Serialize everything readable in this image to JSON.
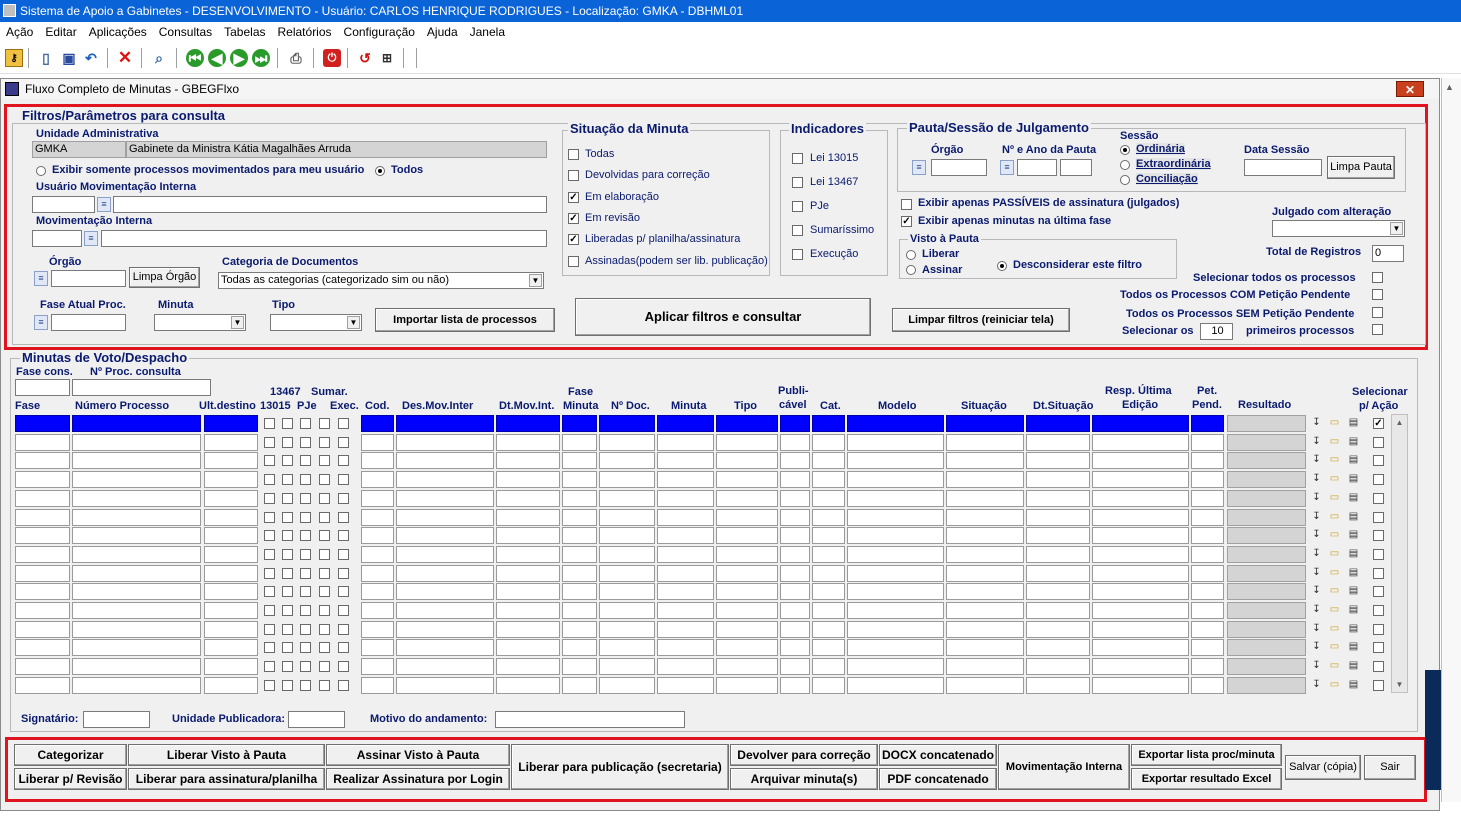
{
  "window": {
    "title": "Sistema de Apoio a Gabinetes - DESENVOLVIMENTO - Usuário: CARLOS HENRIQUE RODRIGUES - Localização: GMKA - DBHML01"
  },
  "menu": [
    "Ação",
    "Editar",
    "Aplicações",
    "Consultas",
    "Tabelas",
    "Relatórios",
    "Configuração",
    "Ajuda",
    "Janela"
  ],
  "form": {
    "title": "Fluxo Completo de Minutas - GBEGFlxo",
    "close": "✕"
  },
  "filters": {
    "title": "Filtros/Parâmetros para consulta",
    "unidade_label": "Unidade Administrativa",
    "unidade_code": "GMKA",
    "unidade_name": "Gabinete da Ministra Kátia Magalhães Arruda",
    "radio_meus": "Exibir somente processos movimentados para meu usuário",
    "radio_todos": "Todos",
    "usuario_label": "Usuário Movimentação Interna",
    "mov_label": "Movimentação Interna",
    "orgao_label": "Órgão",
    "limpa_orgao": "Limpa Órgão",
    "categoria_label": "Categoria de Documentos",
    "categoria_value": "Todas as categorias (categorizado sim ou não)",
    "fase_label": "Fase Atual Proc.",
    "minuta_label": "Minuta",
    "tipo_label": "Tipo",
    "importar": "Importar lista de processos",
    "aplicar": "Aplicar filtros e consultar",
    "limpar": "Limpar filtros (reiniciar tela)"
  },
  "situacao": {
    "title": "Situação da Minuta",
    "items": [
      {
        "label": "Todas",
        "checked": ""
      },
      {
        "label": "Devolvidas para correção",
        "checked": ""
      },
      {
        "label": "Em elaboração",
        "checked": "✓"
      },
      {
        "label": "Em revisão",
        "checked": "✓"
      },
      {
        "label": "Liberadas p/ planilha/assinatura",
        "checked": "✓"
      },
      {
        "label": "Assinadas(podem ser lib. publicação)",
        "checked": ""
      }
    ]
  },
  "indicadores": {
    "title": "Indicadores",
    "items": [
      {
        "label": "Lei 13015",
        "checked": ""
      },
      {
        "label": "Lei 13467",
        "checked": ""
      },
      {
        "label": "PJe",
        "checked": ""
      },
      {
        "label": "Sumaríssimo",
        "checked": ""
      },
      {
        "label": "Execução",
        "checked": ""
      }
    ]
  },
  "pauta": {
    "title": "Pauta/Sessão de Julgamento",
    "orgao": "Órgão",
    "numero_ano": "Nº e Ano da Pauta",
    "sessao": "Sessão",
    "ordinaria": "Ordinária",
    "extraordinaria": "Extraordinária",
    "conciliacao": "Conciliação",
    "data_sessao": "Data Sessão",
    "limpa_pauta": "Limpa Pauta",
    "passiveis": "Exibir apenas PASSÍVEIS de assinatura (julgados)",
    "passiveis_checked": "",
    "ultima_fase": "Exibir apenas minutas na última fase",
    "ultima_fase_checked": "✓",
    "visto_title": "Visto à Pauta",
    "liberar": "Liberar",
    "assinar": "Assinar",
    "desconsiderar": "Desconsiderar este filtro",
    "julgado": "Julgado com alteração",
    "total_label": "Total de Registros",
    "total_value": "0",
    "sel_todos": "Selecionar todos os processos",
    "com_peticao": "Todos os Processos COM Petição Pendente",
    "sem_peticao": "Todos os Processos SEM Petição Pendente",
    "selecionar_os": "Selecionar os",
    "selecionar_n": "10",
    "primeiros": "primeiros processos"
  },
  "grid": {
    "title": "Minutas de Voto/Despacho",
    "fase_cons": "Fase cons.",
    "n_proc_consulta": "Nº Proc. consulta",
    "headers": {
      "fase": "Fase",
      "numero": "Número Processo",
      "ult": "Ult.destino",
      "l13467": "13467",
      "l13015": "13015",
      "pje": "PJe",
      "sumar": "Sumar.",
      "exec": "Exec.",
      "cod": "Cod.",
      "desmov": "Des.Mov.Inter",
      "dtmov": "Dt.Mov.Int.",
      "fase_top": "Fase",
      "fase_bot": "Minuta",
      "ndoc": "Nº Doc.",
      "minuta": "Minuta",
      "tipo": "Tipo",
      "pub_top": "Publi-",
      "pub_bot": "cável",
      "cat": "Cat.",
      "modelo": "Modelo",
      "situacao": "Situação",
      "dtsit": "Dt.Situação",
      "resp_top": "Resp. Última",
      "resp_bot": "Edição",
      "pet_top": "Pet.",
      "pet_bot": "Pend.",
      "resultado": "Resultado",
      "sel_top": "Selecionar",
      "sel_bot": "p/ Ação"
    },
    "row_count": 15,
    "first_row_selected_checked": "✓"
  },
  "footer": {
    "signatario": "Signatário:",
    "unidade_pub": "Unidade Publicadora:",
    "motivo": "Motivo do andamento:"
  },
  "actions": {
    "categorizar": "Categorizar",
    "liberar_revisao": "Liberar p/ Revisão",
    "liberar_visto": "Liberar Visto à Pauta",
    "liberar_assinatura": "Liberar para assinatura/planilha",
    "assinar_visto": "Assinar Visto à Pauta",
    "realizar_assinatura": "Realizar Assinatura por Login",
    "liberar_publicacao": "Liberar para publicação (secretaria)",
    "devolver": "Devolver para correção",
    "arquivar": "Arquivar minuta(s)",
    "docx": "DOCX concatenado",
    "pdf": "PDF concatenado",
    "movimentacao": "Movimentação Interna",
    "exportar_lista": "Exportar lista proc/minuta",
    "exportar_excel": "Exportar resultado Excel",
    "salvar": "Salvar (cópia)",
    "sair": "Sair"
  }
}
